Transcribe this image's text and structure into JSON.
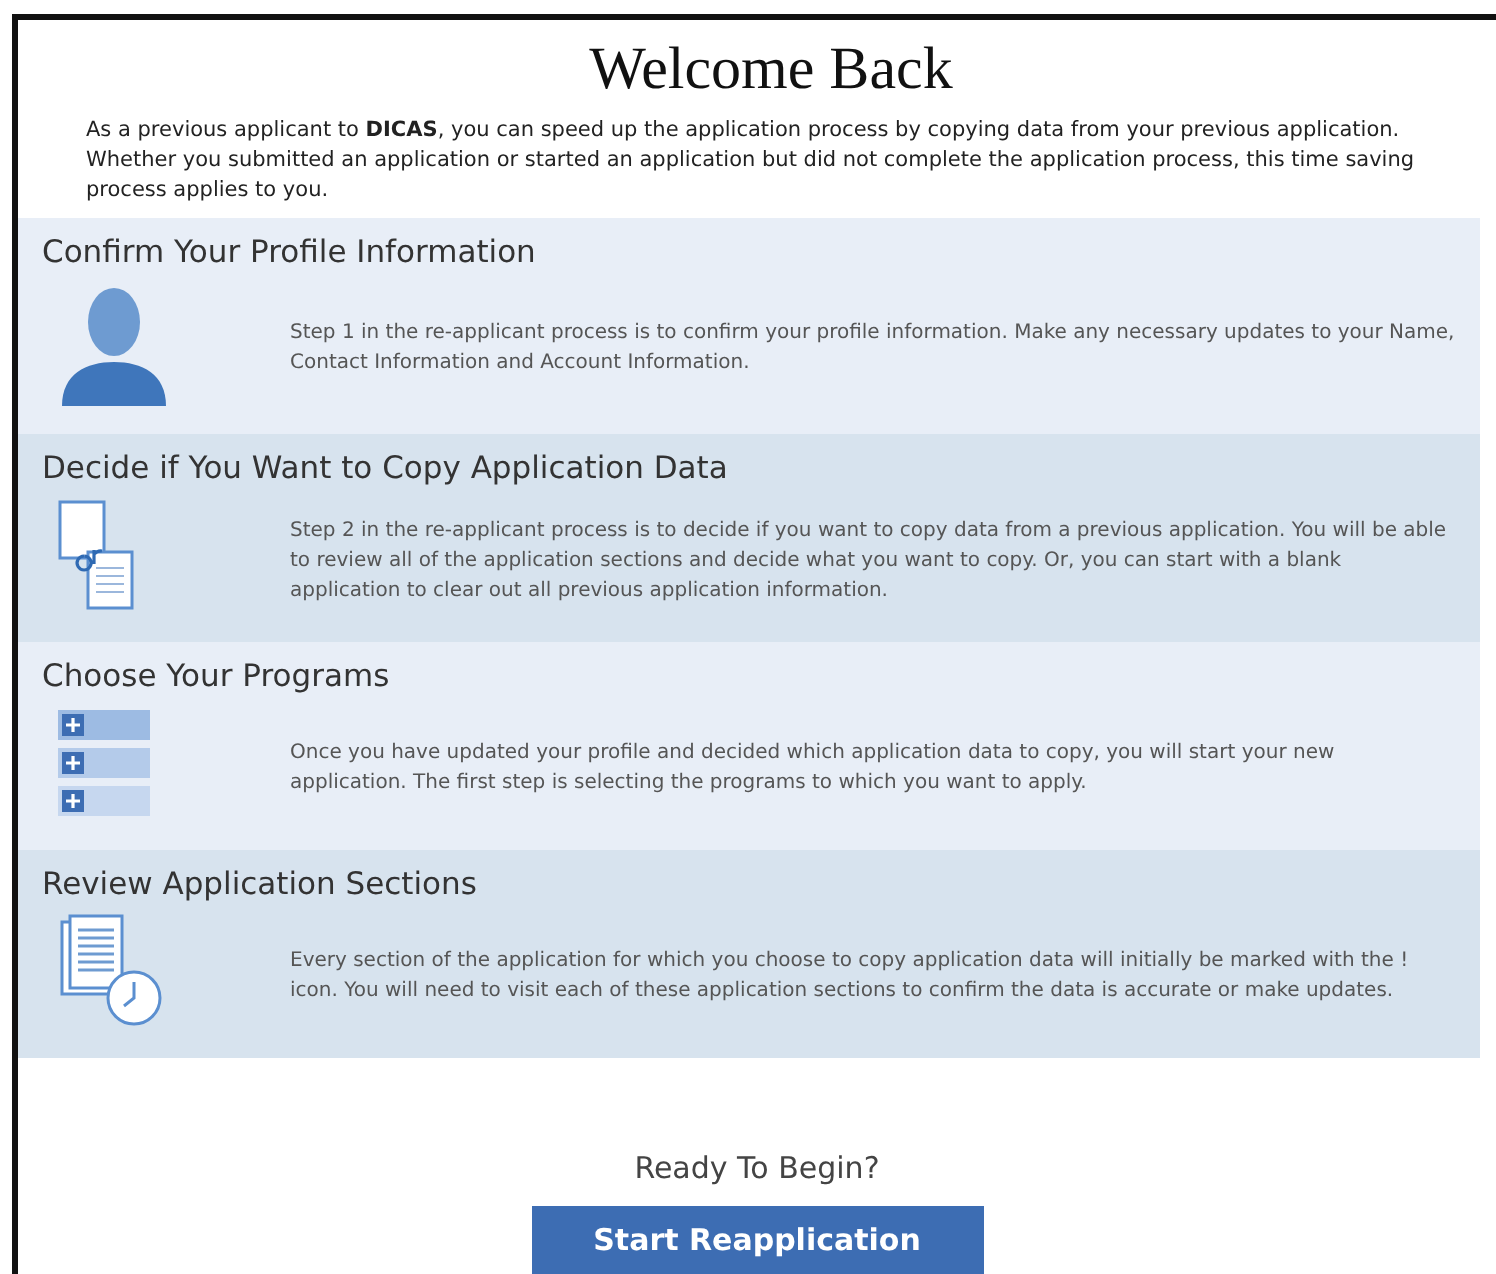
{
  "title": "Welcome Back",
  "intro": "As a previous applicant to **DICAS**, you can speed up the application process by copying data from your previous application. Whether you submitted an application or started an application but did not complete the application process, this time saving process applies to you.",
  "sections": [
    {
      "heading": "Confirm Your Profile Information",
      "text": "Step 1 in the re-applicant process is to confirm your profile information. Make any necessary updates to your Name, Contact Information and Account Information."
    },
    {
      "heading": "Decide if You Want to Copy Application Data",
      "text": "Step 2 in the re-applicant process is to decide if you want to copy data from a previous application. You will be able to review all of the application sections and decide what you want to copy. Or, you can start with a blank application to clear out all previous application information."
    },
    {
      "heading": "Choose Your Programs",
      "text": "Once you have updated your profile and decided which application data to copy, you will start your new application. The first step is selecting the programs to which you want to apply."
    },
    {
      "heading": "Review Application Sections",
      "text": "Every section of the application for which you choose to copy application data will initially be marked with the ! icon. You will need to visit each of these application sections to confirm the data is accurate or make updates."
    }
  ],
  "prompt": "Ready To Begin?",
  "button": "Start Reapplication"
}
